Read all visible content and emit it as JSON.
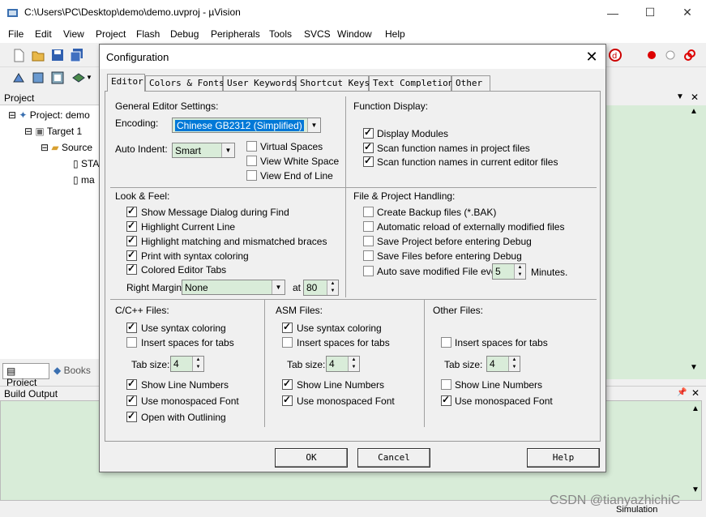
{
  "window": {
    "title": "C:\\Users\\PC\\Desktop\\demo\\demo.uvproj - µVision",
    "minimize": "—",
    "maximize": "☐",
    "close": "✕"
  },
  "menu": [
    "File",
    "Edit",
    "View",
    "Project",
    "Flash",
    "Debug",
    "Peripherals",
    "Tools",
    "SVCS",
    "Window",
    "Help"
  ],
  "project_panel": {
    "title": "Project",
    "tree": [
      "Project: demo",
      "Target 1",
      "Source",
      "STA",
      "ma"
    ],
    "tabs": [
      "Project",
      "Books"
    ]
  },
  "build_output": {
    "title": "Build Output"
  },
  "status": {
    "simulation": "Simulation"
  },
  "watermark": "CSDN @tianyazhichiC",
  "dialog": {
    "title": "Configuration",
    "tabs": [
      "Editor",
      "Colors & Fonts",
      "User Keywords",
      "Shortcut Keys",
      "Text Completion",
      "Other"
    ],
    "general": {
      "heading": "General Editor Settings:",
      "encoding_label": "Encoding:",
      "encoding_value": "Chinese GB2312 (Simplified)",
      "auto_indent_label": "Auto Indent:",
      "auto_indent_value": "Smart",
      "virtual_spaces": "Virtual Spaces",
      "view_white_space": "View White Space",
      "view_end_of_line": "View End of Line"
    },
    "function_display": {
      "heading": "Function Display:",
      "display_modules": "Display Modules",
      "scan_project": "Scan function names in project files",
      "scan_editor": "Scan function names in current editor files"
    },
    "look_feel": {
      "heading": "Look & Feel:",
      "show_message": "Show Message Dialog during Find",
      "highlight_line": "Highlight Current Line",
      "highlight_braces": "Highlight matching and mismatched braces",
      "print_syntax": "Print with syntax coloring",
      "colored_tabs": "Colored Editor Tabs",
      "right_margin_label": "Right Margin:",
      "right_margin_value": "None",
      "at_label": "at",
      "at_value": "80"
    },
    "file_handling": {
      "heading": "File & Project Handling:",
      "create_backup": "Create Backup files (*.BAK)",
      "auto_reload": "Automatic reload of externally modified files",
      "save_project": "Save Project before entering Debug",
      "save_files": "Save Files before entering Debug",
      "auto_save": "Auto save modified File every",
      "auto_save_value": "5",
      "minutes": "Minutes."
    },
    "cpp": {
      "heading": "C/C++ Files:",
      "syntax": "Use syntax coloring",
      "insert_spaces": "Insert spaces for tabs",
      "tab_size_label": "Tab size:",
      "tab_size": "4",
      "line_numbers": "Show Line Numbers",
      "monospaced": "Use monospaced Font",
      "outlining": "Open with Outlining"
    },
    "asm": {
      "heading": "ASM Files:",
      "syntax": "Use syntax coloring",
      "insert_spaces": "Insert spaces for tabs",
      "tab_size_label": "Tab size:",
      "tab_size": "4",
      "line_numbers": "Show Line Numbers",
      "monospaced": "Use monospaced Font"
    },
    "other": {
      "heading": "Other Files:",
      "insert_spaces": "Insert spaces for tabs",
      "tab_size_label": "Tab size:",
      "tab_size": "4",
      "line_numbers": "Show Line Numbers",
      "monospaced": "Use monospaced Font"
    },
    "buttons": {
      "ok": "OK",
      "cancel": "Cancel",
      "help": "Help"
    }
  }
}
